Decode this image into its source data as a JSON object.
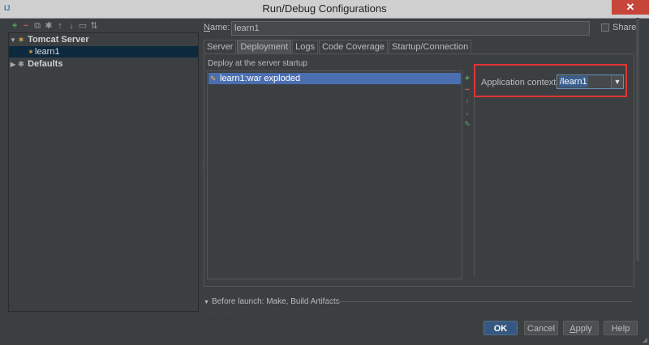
{
  "window": {
    "title": "Run/Debug Configurations",
    "app_icon": "IJ",
    "close_glyph": "✕"
  },
  "toolbar": {
    "items": [
      {
        "icon": "add-icon",
        "glyph": "+"
      },
      {
        "icon": "remove-icon",
        "glyph": "−"
      },
      {
        "icon": "copy-icon",
        "glyph": "⧉"
      },
      {
        "icon": "settings-icon",
        "glyph": "✱"
      },
      {
        "icon": "move-up-icon",
        "glyph": "↑"
      },
      {
        "icon": "move-down-icon",
        "glyph": "↓"
      },
      {
        "icon": "folder-icon",
        "glyph": "▭"
      },
      {
        "icon": "sort-icon",
        "glyph": "⇅"
      }
    ]
  },
  "tree": {
    "tomcat_server": {
      "label": "Tomcat Server",
      "arrow": "▼",
      "icon": "tomcat-icon",
      "glyph": "✶"
    },
    "learn1": {
      "label": "learn1",
      "icon": "tomcat-icon",
      "glyph": "✶"
    },
    "defaults": {
      "label": "Defaults",
      "arrow": "▶",
      "icon": "wrench-icon",
      "glyph": "✱"
    }
  },
  "form": {
    "name_label_underlined": "N",
    "name_label_rest": "ame:",
    "name_value": "learn1",
    "share_label": "Share"
  },
  "tabs": [
    "Server",
    "Deployment",
    "Logs",
    "Code Coverage",
    "Startup/Connection"
  ],
  "active_tab": "Deployment",
  "deployment": {
    "section_label": "Deploy at the server startup",
    "artifact": "learn1:war exploded",
    "artifact_icon_glyph": "✎",
    "list_toolbar": {
      "add": "+",
      "remove": "−",
      "up": "↑",
      "down": "↓",
      "edit": "✎"
    },
    "context_label": "Application context:",
    "context_value": "/learn1",
    "dropdown_glyph": "▼"
  },
  "before_launch": {
    "label": "Before launch: Make, Build Artifacts",
    "tri": "▼"
  },
  "buttons": {
    "ok": "OK",
    "cancel": "Cancel",
    "apply_underlined": "A",
    "apply_rest": "pply",
    "help": "Help"
  },
  "colors": {
    "background": "#3c3f41",
    "selection": "#4b6eaf",
    "highlight": "#e03535",
    "ok_button": "#365880"
  }
}
